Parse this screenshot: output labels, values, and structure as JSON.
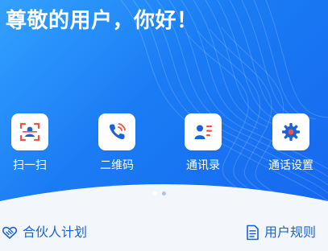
{
  "header": {
    "greeting": "尊敬的用户，你好！"
  },
  "actions": [
    {
      "label": "扫一扫",
      "icon": "scan-icon"
    },
    {
      "label": "二维码",
      "icon": "phone-icon"
    },
    {
      "label": "通讯录",
      "icon": "contacts-icon"
    },
    {
      "label": "通话设置",
      "icon": "gear-icon"
    }
  ],
  "carousel": {
    "page_count": 2,
    "active_page": 1
  },
  "footer": {
    "partner_label": "合伙人计划",
    "partner_icon": "handshake-icon",
    "rules_label": "用户规则",
    "rules_icon": "document-icon"
  },
  "colors": {
    "brand_blue": "#1a7cf4",
    "accent_red": "#f05247",
    "link_blue": "#1a63d6"
  }
}
